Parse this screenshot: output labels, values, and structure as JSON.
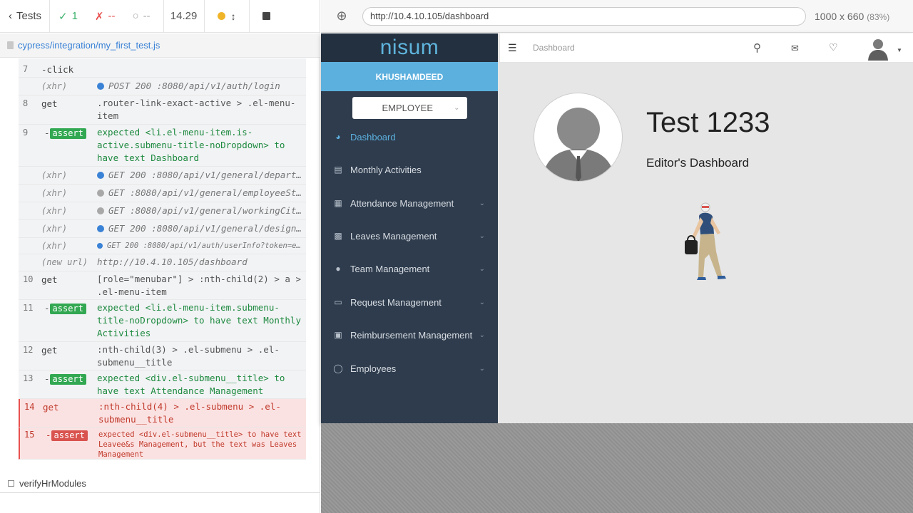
{
  "reporter": {
    "tests_label": "Tests",
    "passed_count": "1",
    "failed_count": "--",
    "pending_count": "--",
    "duration": "14.29",
    "spec_path": "cypress/integration/my_first_test.js",
    "test_title": "verifyHrModules",
    "commands": [
      {
        "num": "7",
        "name": "-click",
        "msg": ""
      },
      {
        "num": "",
        "name": "(xhr)",
        "dot": "blue",
        "msg": "POST 200 :8080/api/v1/auth/login"
      },
      {
        "num": "8",
        "name": "get",
        "msg": ".router-link-exact-active > .el-menu-item"
      },
      {
        "num": "9",
        "name": "assert",
        "msg_prefix": "expected ",
        "msg_target": "<li.el-menu-item.is-active.submenu-title-noDropdown>",
        "msg_mid": " to have text ",
        "msg_value": "Dashboard"
      },
      {
        "num": "",
        "name": "(xhr)",
        "dot": "blue",
        "msg": "GET 200 :8080/api/v1/general/departm…"
      },
      {
        "num": "",
        "name": "(xhr)",
        "dot": "grey",
        "msg": "GET :8080/api/v1/general/employeeSta…"
      },
      {
        "num": "",
        "name": "(xhr)",
        "dot": "grey",
        "msg": "GET :8080/api/v1/general/workingCiti…"
      },
      {
        "num": "",
        "name": "(xhr)",
        "dot": "blue",
        "msg": "GET 200 :8080/api/v1/general/designa…"
      },
      {
        "num": "",
        "name": "(xhr)",
        "dot": "blue",
        "msg": "GET 200 :8080/api/v1/auth/userInfo?token=e…"
      },
      {
        "num": "",
        "name": "(new url)",
        "msg": "http://10.4.10.105/dashboard"
      },
      {
        "num": "10",
        "name": "get",
        "msg": "[role=\"menubar\"] > :nth-child(2) > a > .el-menu-item"
      },
      {
        "num": "11",
        "name": "assert",
        "msg_prefix": "expected ",
        "msg_target": "<li.el-menu-item.submenu-title-noDropdown>",
        "msg_mid": " to have text ",
        "msg_value": "Monthly Activities"
      },
      {
        "num": "12",
        "name": "get",
        "msg": ":nth-child(3) > .el-submenu > .el-submenu__title"
      },
      {
        "num": "13",
        "name": "assert",
        "msg_prefix": "expected ",
        "msg_target": "<div.el-submenu__title>",
        "msg_mid": " to have text ",
        "msg_value": "Attendance Management"
      },
      {
        "num": "14",
        "name": "get",
        "msg": ":nth-child(4) > .el-submenu > .el-submenu__title"
      },
      {
        "num": "15",
        "name": "assert",
        "msg_prefix": "expected ",
        "msg_target": "<div.el-submenu__title>",
        "msg_mid": " to have text ",
        "msg_value": "Leavee&s Management",
        "msg_tail": ", but the text was ",
        "msg_actual": "Leaves Management"
      }
    ]
  },
  "browser": {
    "url": "http://10.4.10.105/dashboard",
    "viewport": "1000 x 660",
    "zoom": "(83%)"
  },
  "app": {
    "logo": "nisum",
    "user_name": "KHUSHAMDEED",
    "role": "EMPLOYEE",
    "breadcrumb": "Dashboard",
    "menu": [
      {
        "label": "Dashboard",
        "icon": "dashboard-icon",
        "active": true,
        "has_children": false
      },
      {
        "label": "Monthly Activities",
        "icon": "chart-icon",
        "active": false,
        "has_children": false
      },
      {
        "label": "Attendance Management",
        "icon": "calendar-icon",
        "active": false,
        "has_children": true
      },
      {
        "label": "Leaves Management",
        "icon": "clipboard-icon",
        "active": false,
        "has_children": true
      },
      {
        "label": "Team Management",
        "icon": "team-icon",
        "active": false,
        "has_children": true
      },
      {
        "label": "Request Management",
        "icon": "inbox-icon",
        "active": false,
        "has_children": true
      },
      {
        "label": "Reimbursement Management",
        "icon": "wallet-icon",
        "active": false,
        "has_children": true
      },
      {
        "label": "Employees",
        "icon": "person-icon",
        "active": false,
        "has_children": true
      }
    ],
    "profile_name": "Test 1233",
    "dashboard_subtitle": "Editor's Dashboard"
  },
  "colors": {
    "sidebar_bg": "#2e3c4d",
    "accent": "#5cb0de",
    "passed": "#3bb16b",
    "failed": "#e94f4f"
  }
}
